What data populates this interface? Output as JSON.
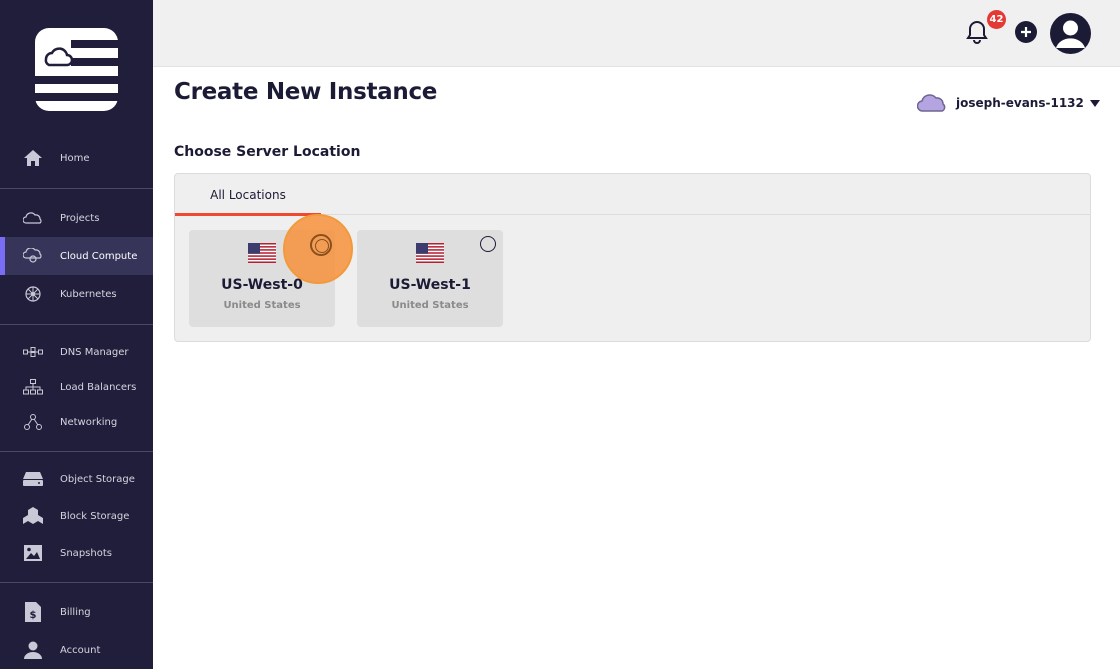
{
  "sidebar": {
    "items": [
      {
        "label": "Home",
        "icon": "home-icon"
      },
      {
        "label": "Projects",
        "icon": "cloud-icon"
      },
      {
        "label": "Cloud Compute",
        "icon": "cloud-compute-icon",
        "active": true
      },
      {
        "label": "Kubernetes",
        "icon": "kubernetes-icon"
      },
      {
        "label": "DNS Manager",
        "icon": "dns-icon"
      },
      {
        "label": "Load Balancers",
        "icon": "load-balancer-icon"
      },
      {
        "label": "Networking",
        "icon": "network-icon"
      },
      {
        "label": "Object Storage",
        "icon": "object-storage-icon"
      },
      {
        "label": "Block Storage",
        "icon": "block-storage-icon"
      },
      {
        "label": "Snapshots",
        "icon": "image-icon"
      },
      {
        "label": "Billing",
        "icon": "billing-icon"
      },
      {
        "label": "Account",
        "icon": "user-icon"
      }
    ]
  },
  "topbar": {
    "notification_count": "42"
  },
  "page": {
    "title": "Create New Instance",
    "account_name": "joseph-evans-1132",
    "section_title": "Choose Server Location"
  },
  "locations": {
    "tabs": [
      {
        "label": "All Locations",
        "active": true
      }
    ],
    "cards": [
      {
        "name": "US-West-0",
        "country": "United States",
        "flag": "us-flag-icon"
      },
      {
        "name": "US-West-1",
        "country": "United States",
        "flag": "us-flag-icon"
      }
    ]
  },
  "colors": {
    "sidebar_bg": "#211e3b",
    "accent_active": "#7b6cf6",
    "tab_underline": "#ef4a2f",
    "badge": "#e53935",
    "highlight": "#f7923c"
  }
}
